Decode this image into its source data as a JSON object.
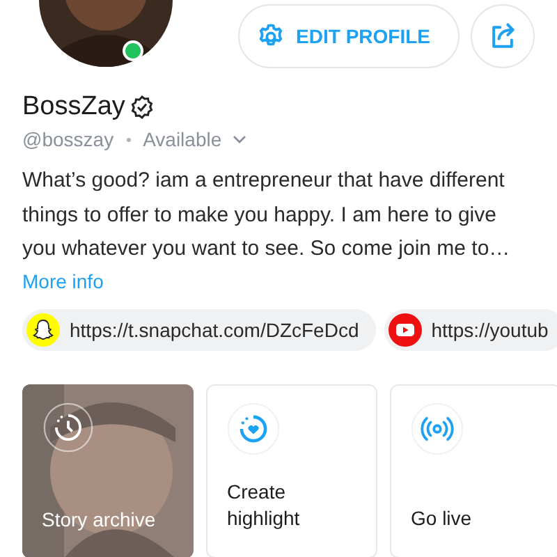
{
  "profile": {
    "online": true,
    "name": "BossZay",
    "verified": true,
    "handle": "@bosszay",
    "status": "Available",
    "bio": "What’s good? iam a entrepreneur that have different things to offer to make you happy. I am here to give you whatever you want to see. So come join me to…",
    "more_link": "More info"
  },
  "actions": {
    "edit_label": "EDIT PROFILE"
  },
  "links": [
    {
      "kind": "snapchat",
      "url": "https://t.snapchat.com/DZcFeDcd"
    },
    {
      "kind": "youtube",
      "url": "https://youtub"
    }
  ],
  "cards": [
    {
      "kind": "archive",
      "label": "Story archive"
    },
    {
      "kind": "highlight",
      "label": "Create highlight"
    },
    {
      "kind": "live",
      "label": "Go live"
    }
  ]
}
